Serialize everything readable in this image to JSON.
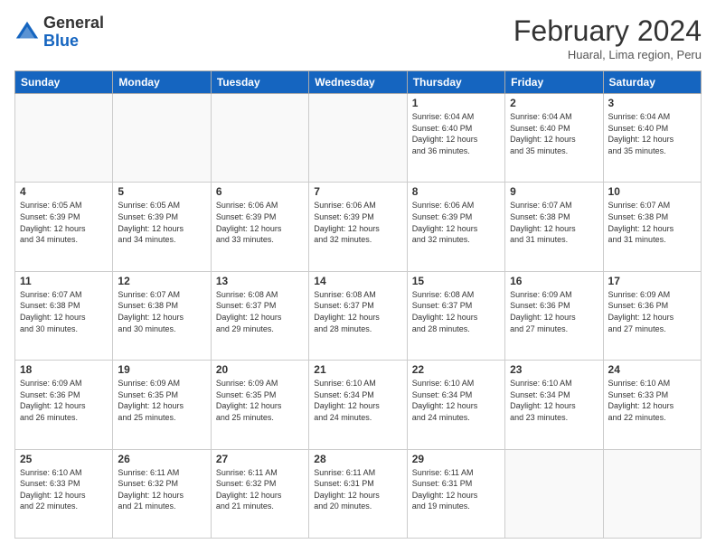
{
  "header": {
    "logo": {
      "line1": "General",
      "line2": "Blue"
    },
    "title": "February 2024",
    "subtitle": "Huaral, Lima region, Peru"
  },
  "days_of_week": [
    "Sunday",
    "Monday",
    "Tuesday",
    "Wednesday",
    "Thursday",
    "Friday",
    "Saturday"
  ],
  "weeks": [
    [
      {
        "day": "",
        "info": ""
      },
      {
        "day": "",
        "info": ""
      },
      {
        "day": "",
        "info": ""
      },
      {
        "day": "",
        "info": ""
      },
      {
        "day": "1",
        "info": "Sunrise: 6:04 AM\nSunset: 6:40 PM\nDaylight: 12 hours\nand 36 minutes."
      },
      {
        "day": "2",
        "info": "Sunrise: 6:04 AM\nSunset: 6:40 PM\nDaylight: 12 hours\nand 35 minutes."
      },
      {
        "day": "3",
        "info": "Sunrise: 6:04 AM\nSunset: 6:40 PM\nDaylight: 12 hours\nand 35 minutes."
      }
    ],
    [
      {
        "day": "4",
        "info": "Sunrise: 6:05 AM\nSunset: 6:39 PM\nDaylight: 12 hours\nand 34 minutes."
      },
      {
        "day": "5",
        "info": "Sunrise: 6:05 AM\nSunset: 6:39 PM\nDaylight: 12 hours\nand 34 minutes."
      },
      {
        "day": "6",
        "info": "Sunrise: 6:06 AM\nSunset: 6:39 PM\nDaylight: 12 hours\nand 33 minutes."
      },
      {
        "day": "7",
        "info": "Sunrise: 6:06 AM\nSunset: 6:39 PM\nDaylight: 12 hours\nand 32 minutes."
      },
      {
        "day": "8",
        "info": "Sunrise: 6:06 AM\nSunset: 6:39 PM\nDaylight: 12 hours\nand 32 minutes."
      },
      {
        "day": "9",
        "info": "Sunrise: 6:07 AM\nSunset: 6:38 PM\nDaylight: 12 hours\nand 31 minutes."
      },
      {
        "day": "10",
        "info": "Sunrise: 6:07 AM\nSunset: 6:38 PM\nDaylight: 12 hours\nand 31 minutes."
      }
    ],
    [
      {
        "day": "11",
        "info": "Sunrise: 6:07 AM\nSunset: 6:38 PM\nDaylight: 12 hours\nand 30 minutes."
      },
      {
        "day": "12",
        "info": "Sunrise: 6:07 AM\nSunset: 6:38 PM\nDaylight: 12 hours\nand 30 minutes."
      },
      {
        "day": "13",
        "info": "Sunrise: 6:08 AM\nSunset: 6:37 PM\nDaylight: 12 hours\nand 29 minutes."
      },
      {
        "day": "14",
        "info": "Sunrise: 6:08 AM\nSunset: 6:37 PM\nDaylight: 12 hours\nand 28 minutes."
      },
      {
        "day": "15",
        "info": "Sunrise: 6:08 AM\nSunset: 6:37 PM\nDaylight: 12 hours\nand 28 minutes."
      },
      {
        "day": "16",
        "info": "Sunrise: 6:09 AM\nSunset: 6:36 PM\nDaylight: 12 hours\nand 27 minutes."
      },
      {
        "day": "17",
        "info": "Sunrise: 6:09 AM\nSunset: 6:36 PM\nDaylight: 12 hours\nand 27 minutes."
      }
    ],
    [
      {
        "day": "18",
        "info": "Sunrise: 6:09 AM\nSunset: 6:36 PM\nDaylight: 12 hours\nand 26 minutes."
      },
      {
        "day": "19",
        "info": "Sunrise: 6:09 AM\nSunset: 6:35 PM\nDaylight: 12 hours\nand 25 minutes."
      },
      {
        "day": "20",
        "info": "Sunrise: 6:09 AM\nSunset: 6:35 PM\nDaylight: 12 hours\nand 25 minutes."
      },
      {
        "day": "21",
        "info": "Sunrise: 6:10 AM\nSunset: 6:34 PM\nDaylight: 12 hours\nand 24 minutes."
      },
      {
        "day": "22",
        "info": "Sunrise: 6:10 AM\nSunset: 6:34 PM\nDaylight: 12 hours\nand 24 minutes."
      },
      {
        "day": "23",
        "info": "Sunrise: 6:10 AM\nSunset: 6:34 PM\nDaylight: 12 hours\nand 23 minutes."
      },
      {
        "day": "24",
        "info": "Sunrise: 6:10 AM\nSunset: 6:33 PM\nDaylight: 12 hours\nand 22 minutes."
      }
    ],
    [
      {
        "day": "25",
        "info": "Sunrise: 6:10 AM\nSunset: 6:33 PM\nDaylight: 12 hours\nand 22 minutes."
      },
      {
        "day": "26",
        "info": "Sunrise: 6:11 AM\nSunset: 6:32 PM\nDaylight: 12 hours\nand 21 minutes."
      },
      {
        "day": "27",
        "info": "Sunrise: 6:11 AM\nSunset: 6:32 PM\nDaylight: 12 hours\nand 21 minutes."
      },
      {
        "day": "28",
        "info": "Sunrise: 6:11 AM\nSunset: 6:31 PM\nDaylight: 12 hours\nand 20 minutes."
      },
      {
        "day": "29",
        "info": "Sunrise: 6:11 AM\nSunset: 6:31 PM\nDaylight: 12 hours\nand 19 minutes."
      },
      {
        "day": "",
        "info": ""
      },
      {
        "day": "",
        "info": ""
      }
    ]
  ]
}
